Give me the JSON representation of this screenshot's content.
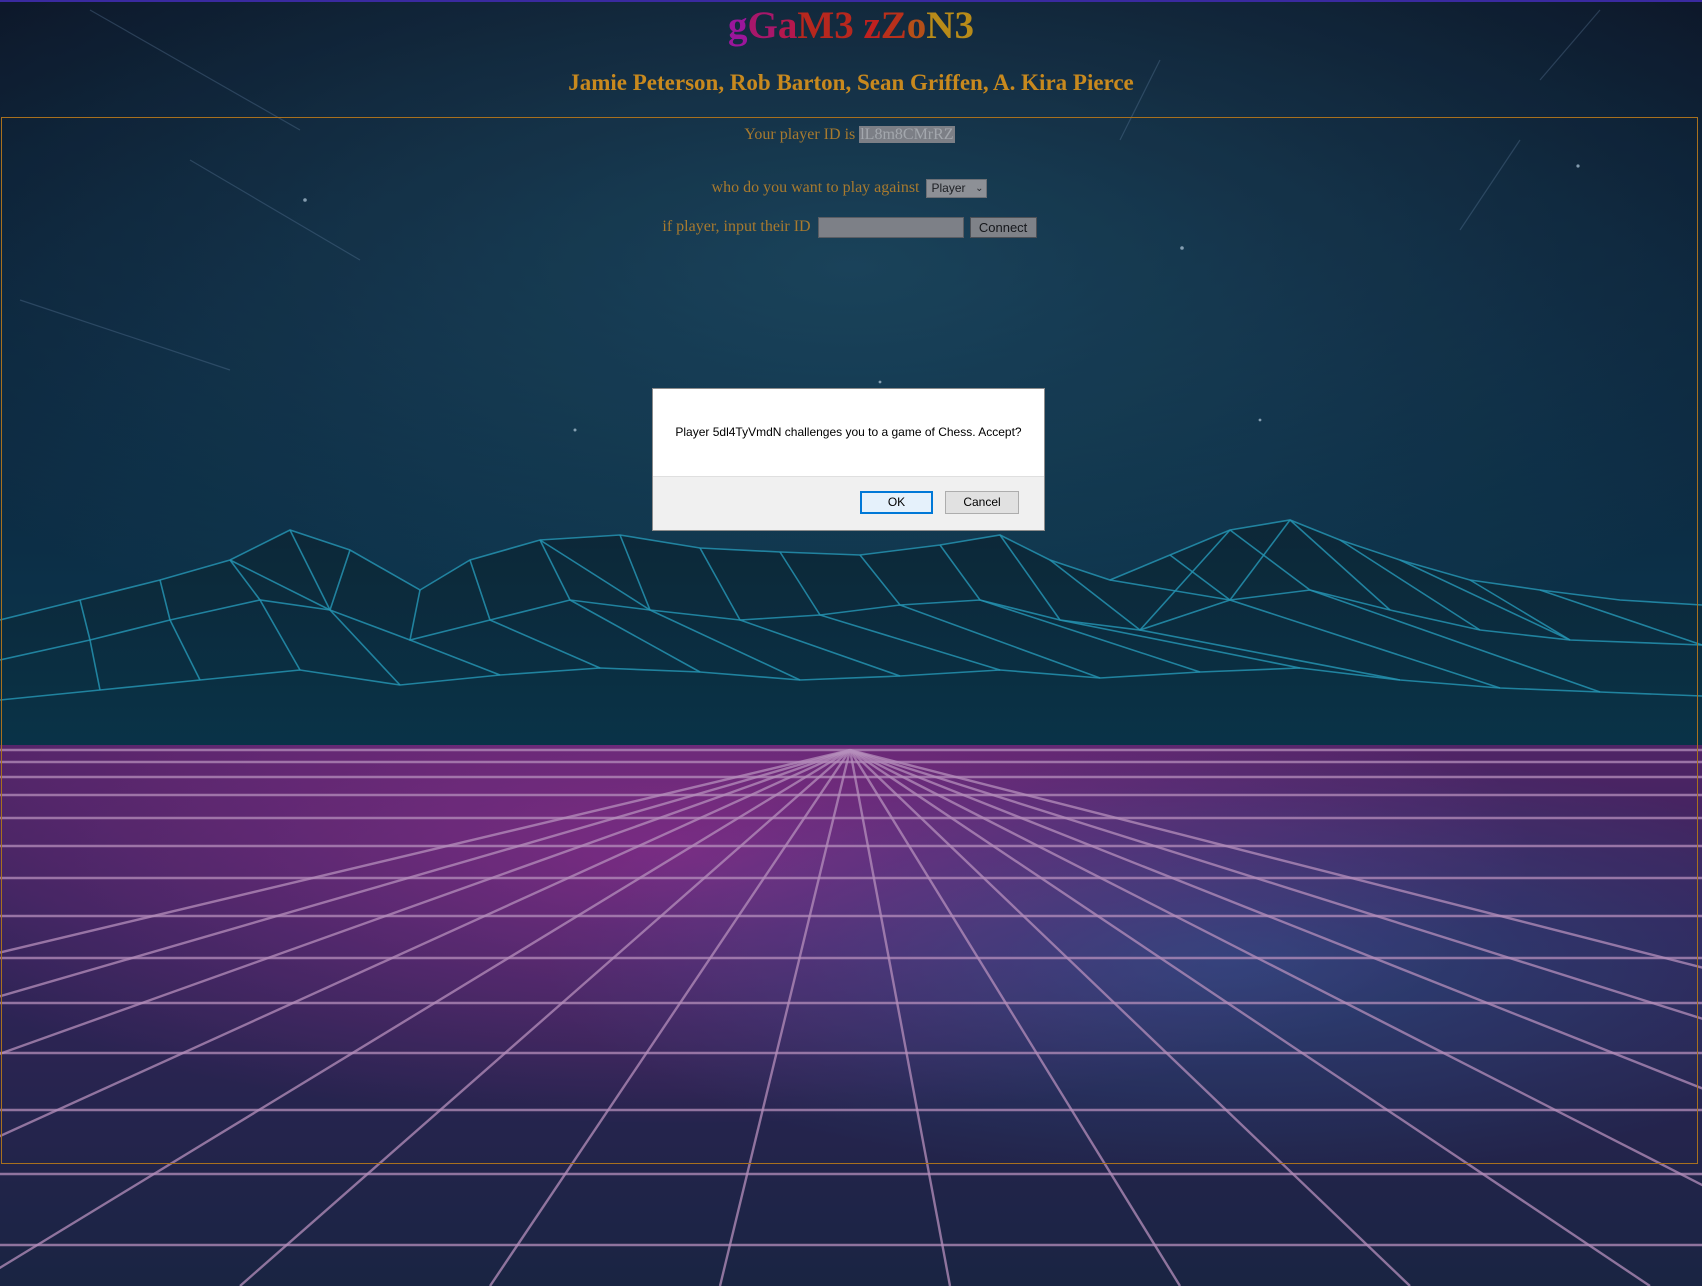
{
  "header": {
    "title_parts": [
      {
        "text": "gGaM3",
        "color": "#a3158a"
      },
      {
        "text": " ",
        "color": "#a3158a"
      },
      {
        "text": "zZoN3",
        "color": "#c0211f"
      }
    ],
    "title_colors": {
      "g": "#9b169b",
      "G": "#a8176a",
      "a": "#b4184d",
      "M3": "#b7271e",
      "z": "#c0211f",
      "Z": "#b8301b",
      "o": "#b54f18",
      "N3": "#b88b19"
    },
    "authors": "Jamie Peterson, Rob Barton, Sean Griffen, A. Kira Pierce"
  },
  "player": {
    "id_prefix": "Your player ID is",
    "id_value": "lL8m8CMrRZ"
  },
  "opponent": {
    "label": "who do you want to play against",
    "selected": "Player"
  },
  "connect_row": {
    "label": "if player, input their ID",
    "input_value": "",
    "button_label": "Connect"
  },
  "dialog": {
    "message": "Player 5dl4TyVmdN challenges you to a game of Chess. Accept?",
    "ok_label": "OK",
    "cancel_label": "Cancel"
  },
  "colors": {
    "accent": "#c8891e",
    "panel_border": "#a8701e",
    "dialog_focus": "#0078d7"
  }
}
